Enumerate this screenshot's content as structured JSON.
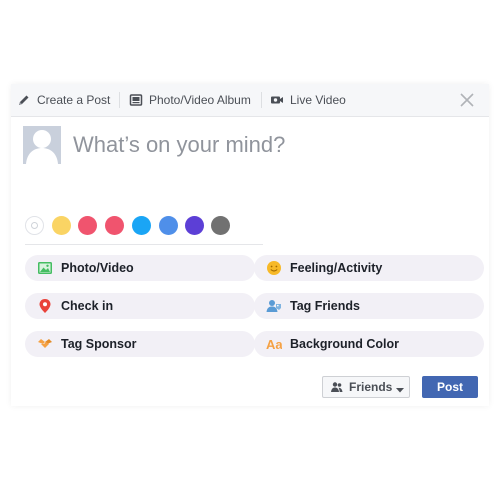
{
  "tabs": [
    {
      "label": "Create a Post",
      "icon": "pencil-icon"
    },
    {
      "label": "Photo/Video Album",
      "icon": "album-icon"
    },
    {
      "label": "Live Video",
      "icon": "video-camera-icon"
    }
  ],
  "close_icon": "close-icon",
  "composer": {
    "placeholder": "What’s on your mind?"
  },
  "background_colors": [
    "#ffffff",
    "#fad464",
    "#f0546e",
    "#f0546e",
    "#1aa5f5",
    "#4f8fe9",
    "#5c3fd6",
    "#717171"
  ],
  "options": [
    {
      "label": "Photo/Video",
      "icon": "photo-icon"
    },
    {
      "label": "Feeling/Activity",
      "icon": "smiley-icon"
    },
    {
      "label": "Check in",
      "icon": "location-pin-icon"
    },
    {
      "label": "Tag Friends",
      "icon": "tag-friends-icon"
    },
    {
      "label": "Tag Sponsor",
      "icon": "handshake-icon"
    },
    {
      "label": "Background Color",
      "icon": "text-aa-icon"
    }
  ],
  "footer": {
    "audience_label": "Friends",
    "post_label": "Post"
  },
  "colors": {
    "primary": "#4267b2",
    "tabbar_bg": "#f6f7f9",
    "option_bg": "#f2f0f6"
  }
}
